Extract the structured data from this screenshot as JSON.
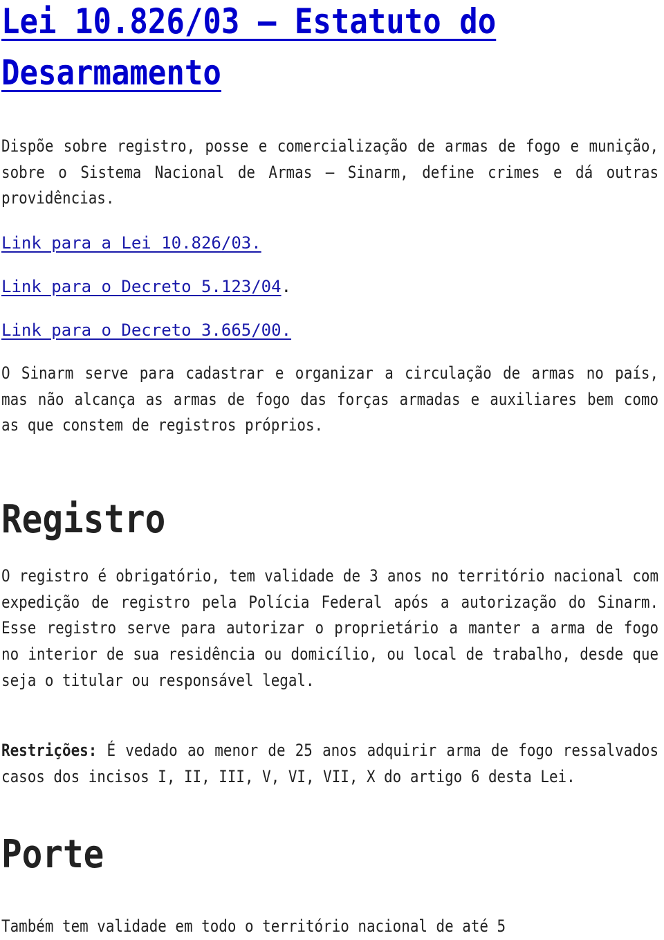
{
  "title": {
    "line1": "Lei 10.826/03 – Estatuto do",
    "line2": "Desarmamento"
  },
  "intro": "Dispõe sobre registro, posse e comercialização de armas de fogo e munição, sobre o Sistema Nacional de Armas – Sinarm, define crimes e dá outras providências.",
  "links": [
    {
      "text": "Link para a Lei 10.826/03.",
      "suffix": ""
    },
    {
      "text": "Link para o Decreto 5.123/04",
      "suffix": "."
    },
    {
      "text": "Link para o Decreto 3.665/00.",
      "suffix": ""
    }
  ],
  "sinarm_paragraph": "O Sinarm serve para cadastrar e organizar a circulação de armas no país, mas não alcança as armas de fogo das forças armadas e auxiliares bem como as que constem de registros próprios.",
  "sections": {
    "registro": {
      "heading": "Registro",
      "paragraph": "O registro é obrigatório, tem validade de 3 anos no território nacional com expedição de registro pela Polícia Federal após a autorização do Sinarm. Esse registro serve para autorizar o proprietário a manter a arma de fogo no interior de sua residência ou domicílio, ou local de trabalho, desde que seja o titular ou responsável legal.",
      "restricoes_label": "Restrições:",
      "restricoes_text": " É vedado ao menor de 25 anos adquirir arma de fogo ressalvados casos dos incisos I, II, III, V, VI, VII, X do artigo 6 desta Lei."
    },
    "porte": {
      "heading": "Porte",
      "paragraph": "Também tem validade em todo o território nacional de até 5"
    }
  },
  "colors": {
    "title_link": "#0000cc",
    "link": "#1a1aaa",
    "text": "#222222"
  }
}
